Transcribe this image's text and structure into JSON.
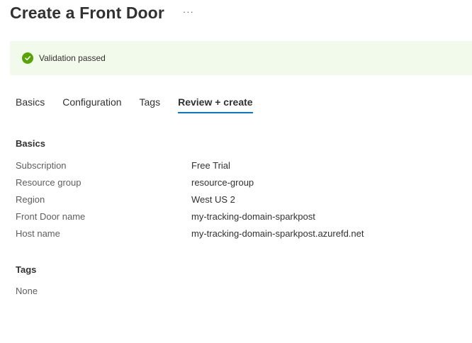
{
  "header": {
    "title": "Create a Front Door",
    "more_label": "···"
  },
  "validation": {
    "message": "Validation passed",
    "status_color": "#57a300",
    "icon": "check-circle-icon"
  },
  "tabs": [
    {
      "label": "Basics"
    },
    {
      "label": "Configuration"
    },
    {
      "label": "Tags"
    },
    {
      "label": "Review + create",
      "active": true
    }
  ],
  "basics": {
    "heading": "Basics",
    "fields": [
      {
        "label": "Subscription",
        "value": "Free Trial"
      },
      {
        "label": "Resource group",
        "value": "resource-group"
      },
      {
        "label": "Region",
        "value": "West US 2"
      },
      {
        "label": "Front Door name",
        "value": "my-tracking-domain-sparkpost"
      },
      {
        "label": "Host name",
        "value": "my-tracking-domain-sparkpost.azurefd.net"
      }
    ]
  },
  "tags": {
    "heading": "Tags",
    "value": "None"
  },
  "colors": {
    "accent": "#0078d4",
    "banner_background": "#f1faeb"
  }
}
